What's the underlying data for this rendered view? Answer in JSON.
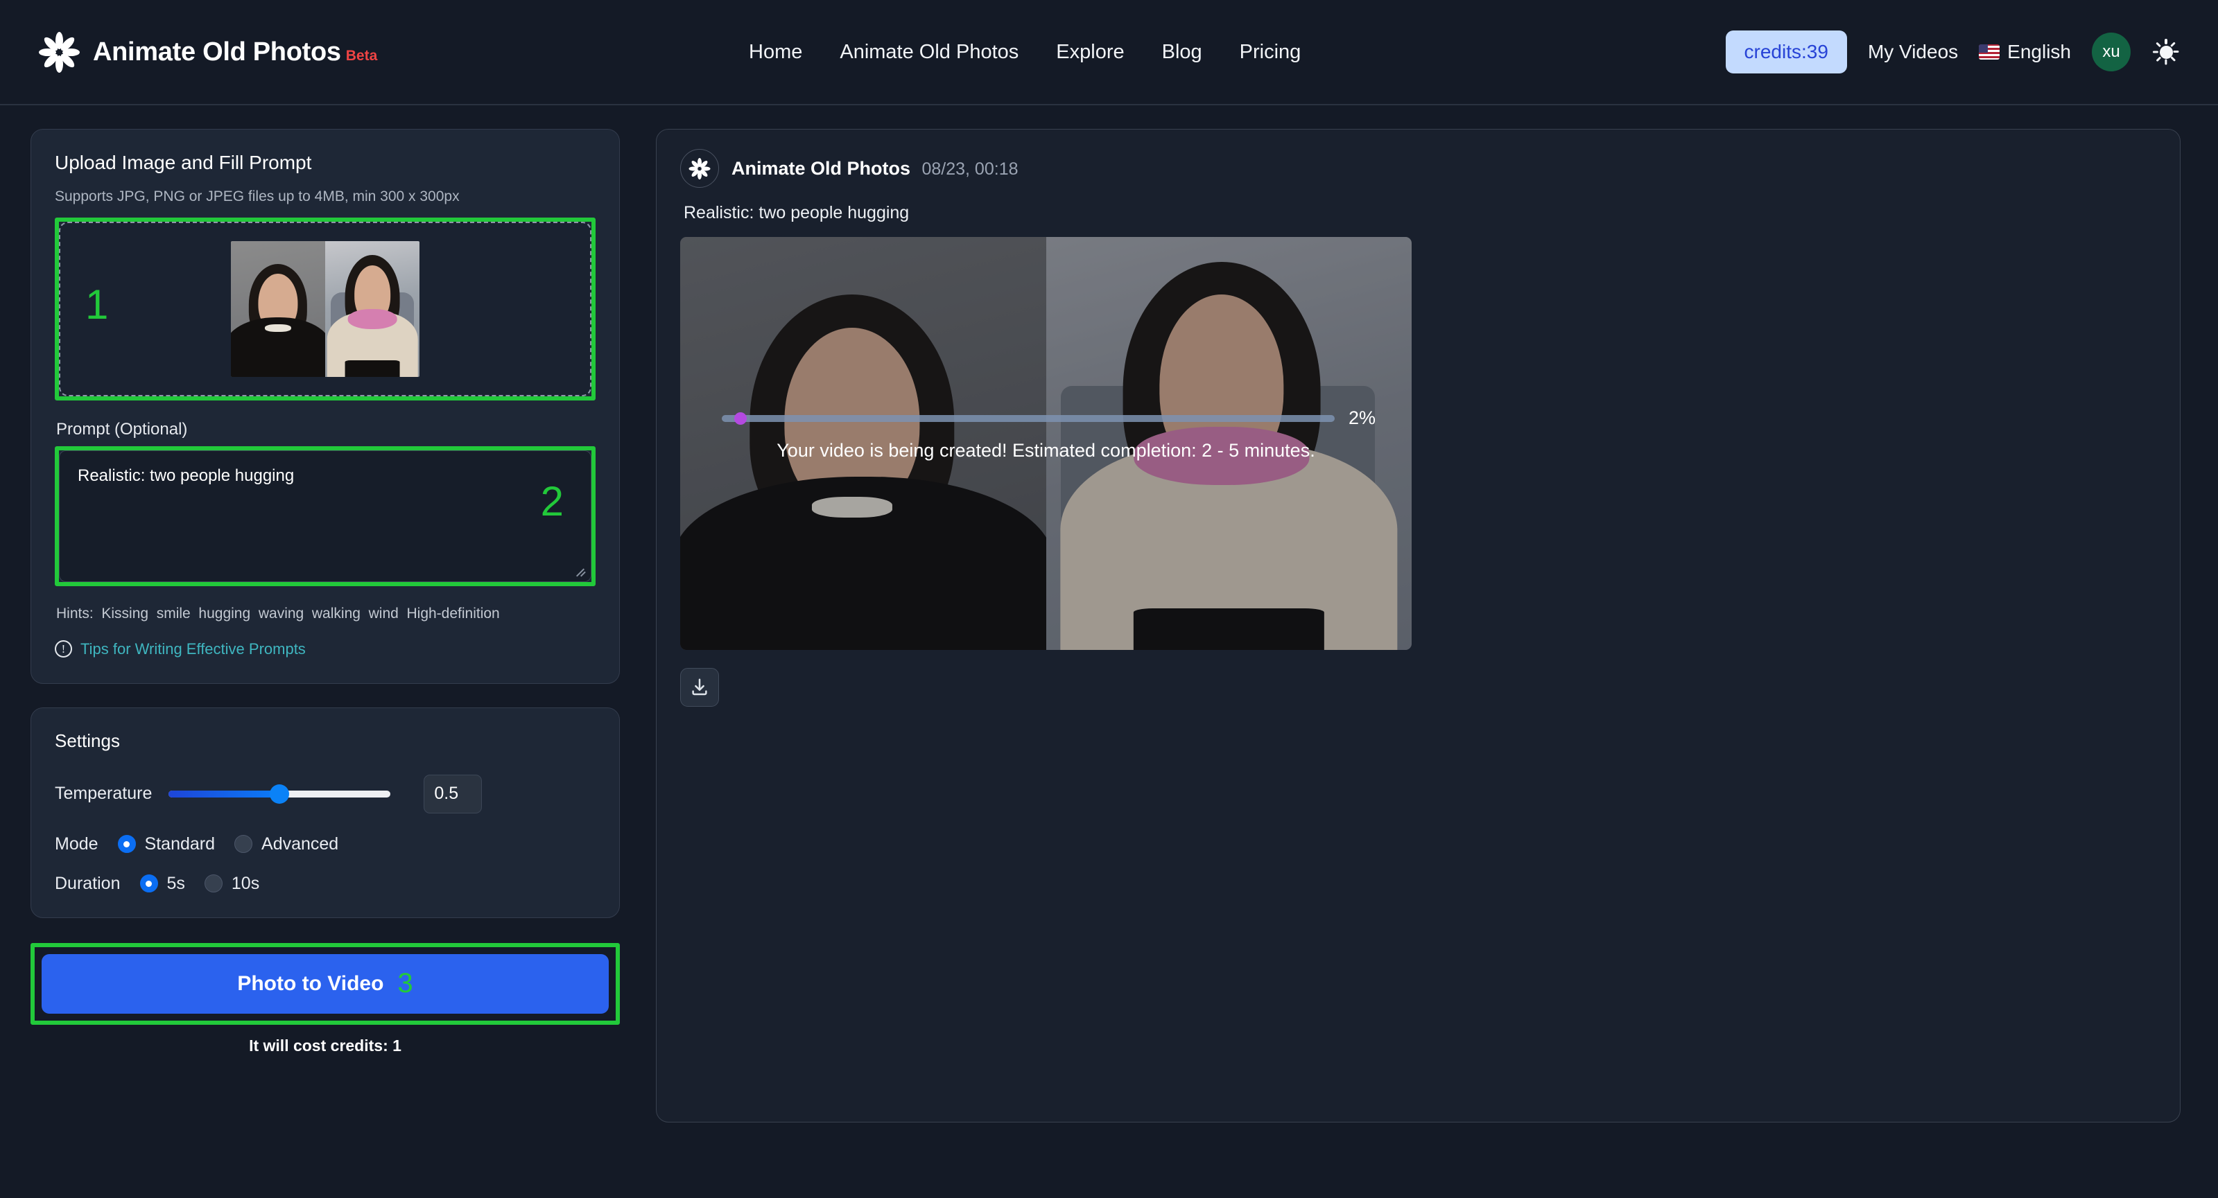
{
  "header": {
    "logo_icon": "flower-spinner-icon",
    "brand_title": "Animate Old Photos",
    "brand_badge": "Beta",
    "nav": [
      {
        "label": "Home",
        "name": "nav-home"
      },
      {
        "label": "Animate Old Photos",
        "name": "nav-animate-old-photos"
      },
      {
        "label": "Explore",
        "name": "nav-explore"
      },
      {
        "label": "Blog",
        "name": "nav-blog"
      },
      {
        "label": "Pricing",
        "name": "nav-pricing"
      }
    ],
    "credits_label": "credits:39",
    "my_videos_label": "My Videos",
    "language_label": "English",
    "language_flag_icon": "us-flag-icon",
    "avatar_initials": "xu",
    "theme_toggle_icon": "sun-icon",
    "colors": {
      "credits_bg": "#c3dafe",
      "credits_text": "#2743d6",
      "beta_text": "#ef4444",
      "avatar_bg": "#136343"
    }
  },
  "upload_card": {
    "title": "Upload Image and Fill Prompt",
    "supports_text": "Supports JPG, PNG or JPEG files up to 4MB, min 300 x 300px",
    "step_number": "1",
    "dropzone_has_image": true,
    "prompt_label": "Prompt (Optional)",
    "prompt_value": "Realistic: two people hugging",
    "prompt_step_number": "2",
    "hints_prefix": "Hints:",
    "hints": [
      "Kissing",
      "smile",
      "hugging",
      "waving",
      "walking",
      "wind",
      "High-definition"
    ],
    "tips_icon": "info-circle-icon",
    "tips_link": "Tips for Writing Effective Prompts",
    "highlight_color": "#22c93a"
  },
  "settings": {
    "title": "Settings",
    "temperature_label": "Temperature",
    "temperature_value": "0.5",
    "temperature_percent": 50,
    "mode_label": "Mode",
    "mode_options": [
      {
        "label": "Standard",
        "selected": true
      },
      {
        "label": "Advanced",
        "selected": false
      }
    ],
    "duration_label": "Duration",
    "duration_options": [
      {
        "label": "5s",
        "selected": true
      },
      {
        "label": "10s",
        "selected": false
      }
    ]
  },
  "cta": {
    "button_label": "Photo to Video",
    "step_number": "3",
    "cost_note": "It will cost credits: 1",
    "button_color": "#2b62ee"
  },
  "result": {
    "avatar_icon": "flower-spinner-icon",
    "name": "Animate Old Photos",
    "timestamp": "08/23, 00:18",
    "prompt": "Realistic: two people hugging",
    "progress_percent_label": "2%",
    "progress_percent": 2,
    "status_message": "Your video is being created! Estimated completion: 2 - 5 minutes.",
    "download_icon": "download-icon"
  }
}
